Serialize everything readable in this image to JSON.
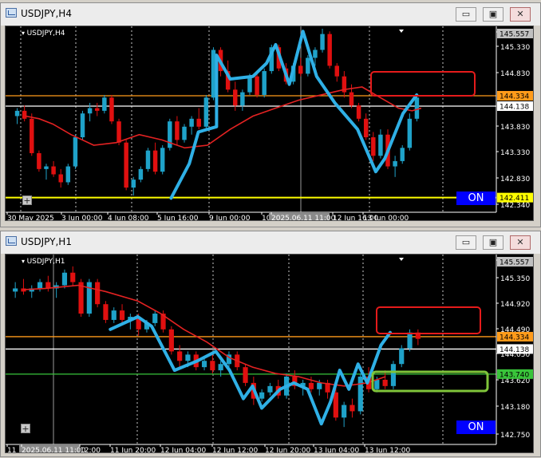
{
  "colors": {
    "bg": "#000000",
    "bull": "#1fa2c9",
    "bear": "#e01010",
    "ma": "#e32222",
    "trend": "#2fb0e6",
    "orange_line": "#ff9b1a",
    "white_line": "#ffffff",
    "yellow_line": "#ffff00",
    "green_line": "#39c43a",
    "red_box": "#e51b1b",
    "green_box": "#7fc43a",
    "on_button": "#0000ff"
  },
  "windows": [
    {
      "title": "USDJPY,H4",
      "symbol_label": "USDJPY,H4",
      "buttons": {
        "minimize": "▭",
        "maximize": "▣",
        "close": "✕"
      },
      "on_label": "ON",
      "plus_label": "+",
      "price_axis": [
        "145.557",
        "145.330",
        "144.830",
        "143.830",
        "143.330",
        "142.830",
        "142.340"
      ],
      "price_tags": [
        {
          "label": "145.557",
          "style": "grey"
        },
        {
          "label": "144.334",
          "style": "orange"
        },
        {
          "label": "144.138",
          "style": "white"
        },
        {
          "label": "142.411",
          "style": "yellow"
        }
      ],
      "time_axis": [
        "30 May 2025",
        "3 Jun 00:00",
        "4 Jun 08:00",
        "5 Jun 16:00",
        "9 Jun 00:00",
        "10 Jun 08:00",
        "2025.06.11 11:00",
        "12 Jun 16:00",
        "13 Jun 00:00"
      ],
      "crosshair_time": "2025.06.11 11:00",
      "chart_data": {
        "type": "candlestick",
        "symbol": "USDJPY",
        "timeframe": "H4",
        "ylim": [
          142.3,
          145.6
        ],
        "horizontal_lines": {
          "orange": 144.334,
          "white": 144.138,
          "yellow": 142.411
        },
        "moving_average_path": [
          [
            0,
            143.95
          ],
          [
            0.03,
            143.9
          ],
          [
            0.06,
            143.8
          ],
          [
            0.1,
            143.6
          ],
          [
            0.15,
            143.4
          ],
          [
            0.2,
            143.45
          ],
          [
            0.25,
            143.6
          ],
          [
            0.3,
            143.5
          ],
          [
            0.35,
            143.35
          ],
          [
            0.4,
            143.4
          ],
          [
            0.45,
            143.7
          ],
          [
            0.5,
            143.95
          ],
          [
            0.55,
            144.1
          ],
          [
            0.6,
            144.25
          ],
          [
            0.65,
            144.35
          ],
          [
            0.7,
            144.45
          ],
          [
            0.74,
            144.5
          ],
          [
            0.78,
            144.3
          ],
          [
            0.82,
            144.1
          ],
          [
            0.85,
            144.05
          ],
          [
            0.87,
            144.1
          ]
        ],
        "trend_path": [
          [
            0.32,
            142.4
          ],
          [
            0.36,
            143.05
          ],
          [
            0.38,
            143.65
          ],
          [
            0.42,
            143.75
          ],
          [
            0.42,
            145.1
          ],
          [
            0.45,
            144.65
          ],
          [
            0.5,
            144.7
          ],
          [
            0.53,
            144.95
          ],
          [
            0.55,
            145.3
          ],
          [
            0.58,
            144.55
          ],
          [
            0.61,
            145.55
          ],
          [
            0.64,
            144.7
          ],
          [
            0.68,
            144.2
          ],
          [
            0.73,
            143.7
          ],
          [
            0.77,
            142.9
          ],
          [
            0.79,
            143.15
          ],
          [
            0.83,
            144.0
          ],
          [
            0.86,
            144.35
          ]
        ],
        "candles": [
          [
            143.95,
            144.1,
            143.8,
            144.05
          ],
          [
            144.05,
            144.15,
            143.85,
            143.9
          ],
          [
            143.9,
            144.0,
            143.2,
            143.25
          ],
          [
            143.25,
            143.3,
            142.9,
            142.95
          ],
          [
            142.95,
            143.05,
            142.75,
            143.0
          ],
          [
            143.0,
            143.1,
            142.8,
            142.85
          ],
          [
            142.85,
            142.95,
            142.6,
            142.7
          ],
          [
            142.7,
            143.05,
            142.65,
            143.0
          ],
          [
            143.0,
            143.6,
            142.95,
            143.55
          ],
          [
            143.55,
            144.05,
            143.5,
            144.0
          ],
          [
            144.0,
            144.2,
            143.85,
            144.1
          ],
          [
            144.1,
            144.2,
            143.95,
            144.05
          ],
          [
            144.05,
            144.35,
            144.0,
            144.3
          ],
          [
            144.3,
            144.35,
            143.8,
            143.85
          ],
          [
            143.85,
            143.9,
            143.4,
            143.45
          ],
          [
            143.45,
            143.5,
            142.55,
            142.6
          ],
          [
            142.6,
            142.8,
            142.45,
            142.75
          ],
          [
            142.75,
            143.0,
            142.7,
            142.95
          ],
          [
            142.95,
            143.35,
            142.9,
            143.3
          ],
          [
            143.3,
            143.45,
            142.85,
            142.9
          ],
          [
            142.9,
            143.4,
            142.85,
            143.35
          ],
          [
            143.35,
            143.9,
            143.3,
            143.85
          ],
          [
            143.85,
            143.95,
            143.4,
            143.5
          ],
          [
            143.5,
            143.8,
            143.45,
            143.75
          ],
          [
            143.75,
            143.95,
            143.6,
            143.9
          ],
          [
            143.9,
            144.1,
            143.7,
            143.75
          ],
          [
            143.75,
            144.35,
            143.7,
            144.3
          ],
          [
            144.3,
            145.25,
            144.25,
            145.2
          ],
          [
            145.2,
            145.25,
            144.7,
            144.8
          ],
          [
            144.8,
            145.0,
            144.4,
            144.45
          ],
          [
            144.45,
            144.6,
            144.05,
            144.15
          ],
          [
            144.15,
            144.45,
            144.05,
            144.4
          ],
          [
            144.4,
            144.75,
            144.35,
            144.7
          ],
          [
            144.7,
            144.8,
            144.3,
            144.35
          ],
          [
            144.35,
            144.85,
            144.3,
            144.8
          ],
          [
            144.8,
            145.3,
            144.75,
            145.25
          ],
          [
            145.25,
            145.3,
            144.8,
            144.85
          ],
          [
            144.85,
            144.95,
            144.55,
            144.6
          ],
          [
            144.6,
            144.95,
            144.55,
            144.9
          ],
          [
            144.9,
            145.05,
            144.7,
            144.75
          ],
          [
            144.75,
            145.1,
            144.7,
            145.05
          ],
          [
            145.05,
            145.25,
            144.9,
            145.2
          ],
          [
            145.2,
            145.6,
            145.15,
            145.5
          ],
          [
            145.5,
            145.55,
            144.85,
            144.9
          ],
          [
            144.9,
            144.95,
            144.6,
            144.7
          ],
          [
            144.7,
            144.8,
            144.3,
            144.4
          ],
          [
            144.4,
            144.55,
            144.1,
            144.15
          ],
          [
            144.15,
            144.2,
            143.85,
            143.9
          ],
          [
            143.9,
            144.0,
            143.5,
            143.55
          ],
          [
            143.55,
            143.65,
            143.1,
            143.2
          ],
          [
            143.2,
            143.7,
            143.15,
            143.6
          ],
          [
            143.6,
            143.7,
            142.95,
            143.0
          ],
          [
            143.0,
            143.2,
            142.8,
            143.1
          ],
          [
            143.1,
            143.4,
            143.05,
            143.35
          ],
          [
            143.35,
            144.0,
            143.3,
            143.9
          ],
          [
            143.9,
            144.35,
            143.85,
            144.3
          ]
        ]
      }
    },
    {
      "title": "USDJPY,H1",
      "symbol_label": "USDJPY,H1",
      "buttons": {
        "minimize": "▭",
        "maximize": "▣",
        "close": "✕"
      },
      "on_label": "ON",
      "plus_label": "+",
      "price_axis": [
        "145.557",
        "145.350",
        "144.920",
        "144.490",
        "144.050",
        "143.620",
        "143.180",
        "142.750"
      ],
      "price_tags": [
        {
          "label": "145.557",
          "style": "grey"
        },
        {
          "label": "144.334",
          "style": "orange"
        },
        {
          "label": "144.138",
          "style": "white"
        },
        {
          "label": "143.740",
          "style": "green"
        }
      ],
      "time_axis": [
        "11 Jun",
        "2025.06.11 11:00",
        "12:00",
        "11 Jun 20:00",
        "12 Jun 04:00",
        "12 Jun 12:00",
        "12 Jun 20:00",
        "13 Jun 04:00",
        "13 Jun 12:00"
      ],
      "crosshair_time": "2025.06.11 11:00",
      "chart_data": {
        "type": "candlestick",
        "symbol": "USDJPY",
        "timeframe": "H1",
        "ylim": [
          142.75,
          145.6
        ],
        "horizontal_lines": {
          "orange": 144.334,
          "white": 144.138,
          "green": 143.74
        },
        "moving_average_path": [
          [
            0,
            145.08
          ],
          [
            0.05,
            145.1
          ],
          [
            0.12,
            145.15
          ],
          [
            0.18,
            145.05
          ],
          [
            0.25,
            144.9
          ],
          [
            0.3,
            144.7
          ],
          [
            0.35,
            144.45
          ],
          [
            0.4,
            144.25
          ],
          [
            0.45,
            144.0
          ],
          [
            0.5,
            143.85
          ],
          [
            0.55,
            143.75
          ],
          [
            0.6,
            143.7
          ],
          [
            0.65,
            143.6
          ],
          [
            0.7,
            143.55
          ],
          [
            0.75,
            143.6
          ],
          [
            0.79,
            143.7
          ]
        ],
        "trend_path": [
          [
            0.19,
            144.45
          ],
          [
            0.25,
            144.65
          ],
          [
            0.28,
            144.5
          ],
          [
            0.33,
            143.8
          ],
          [
            0.38,
            143.95
          ],
          [
            0.42,
            144.1
          ],
          [
            0.45,
            143.8
          ],
          [
            0.48,
            143.35
          ],
          [
            0.5,
            143.55
          ],
          [
            0.52,
            143.2
          ],
          [
            0.56,
            143.5
          ],
          [
            0.59,
            143.6
          ],
          [
            0.62,
            143.5
          ],
          [
            0.65,
            142.95
          ],
          [
            0.67,
            143.3
          ],
          [
            0.69,
            143.8
          ],
          [
            0.71,
            143.5
          ],
          [
            0.73,
            143.9
          ],
          [
            0.75,
            143.6
          ],
          [
            0.78,
            144.2
          ],
          [
            0.8,
            144.4
          ]
        ],
        "candles": [
          [
            145.05,
            145.2,
            144.95,
            145.1
          ],
          [
            145.1,
            145.25,
            145.0,
            145.05
          ],
          [
            145.05,
            145.15,
            144.95,
            145.1
          ],
          [
            145.1,
            145.25,
            145.05,
            145.2
          ],
          [
            145.2,
            145.3,
            145.05,
            145.1
          ],
          [
            145.1,
            145.2,
            144.95,
            145.15
          ],
          [
            145.15,
            145.4,
            145.1,
            145.35
          ],
          [
            145.35,
            145.45,
            145.15,
            145.2
          ],
          [
            145.2,
            145.25,
            144.65,
            144.7
          ],
          [
            144.7,
            145.25,
            144.65,
            145.2
          ],
          [
            145.2,
            145.25,
            144.8,
            144.85
          ],
          [
            144.85,
            144.9,
            144.55,
            144.6
          ],
          [
            144.6,
            144.8,
            144.55,
            144.75
          ],
          [
            144.75,
            144.85,
            144.55,
            144.6
          ],
          [
            144.6,
            144.7,
            144.45,
            144.65
          ],
          [
            144.65,
            144.7,
            144.35,
            144.45
          ],
          [
            144.45,
            144.6,
            144.4,
            144.55
          ],
          [
            144.55,
            144.75,
            144.5,
            144.7
          ],
          [
            144.7,
            144.75,
            144.4,
            144.45
          ],
          [
            144.45,
            144.5,
            144.05,
            144.1
          ],
          [
            144.1,
            144.2,
            143.85,
            143.95
          ],
          [
            143.95,
            144.1,
            143.85,
            144.05
          ],
          [
            144.05,
            144.1,
            143.8,
            143.85
          ],
          [
            143.85,
            144.0,
            143.8,
            143.95
          ],
          [
            143.95,
            144.05,
            143.75,
            143.8
          ],
          [
            143.8,
            143.95,
            143.7,
            143.9
          ],
          [
            143.9,
            144.1,
            143.85,
            144.05
          ],
          [
            144.05,
            144.1,
            143.8,
            143.85
          ],
          [
            143.85,
            143.9,
            143.55,
            143.6
          ],
          [
            143.6,
            143.7,
            143.25,
            143.35
          ],
          [
            143.35,
            143.5,
            143.3,
            143.45
          ],
          [
            143.45,
            143.6,
            143.4,
            143.55
          ],
          [
            143.55,
            143.65,
            143.35,
            143.4
          ],
          [
            143.4,
            143.75,
            143.35,
            143.7
          ],
          [
            143.7,
            143.8,
            143.5,
            143.55
          ],
          [
            143.55,
            143.65,
            143.4,
            143.6
          ],
          [
            143.6,
            143.7,
            143.45,
            143.5
          ],
          [
            143.5,
            143.65,
            143.4,
            143.6
          ],
          [
            143.6,
            143.65,
            143.35,
            143.45
          ],
          [
            143.45,
            143.55,
            143.0,
            143.05
          ],
          [
            143.05,
            143.3,
            142.9,
            143.25
          ],
          [
            143.25,
            143.35,
            143.05,
            143.15
          ],
          [
            143.15,
            143.75,
            143.1,
            143.7
          ],
          [
            143.7,
            143.85,
            143.45,
            143.5
          ],
          [
            143.5,
            143.7,
            143.45,
            143.65
          ],
          [
            143.65,
            143.8,
            143.5,
            143.55
          ],
          [
            143.55,
            143.95,
            143.5,
            143.9
          ],
          [
            143.9,
            144.2,
            143.85,
            144.15
          ],
          [
            144.15,
            144.45,
            144.1,
            144.4
          ],
          [
            144.4,
            144.45,
            144.2,
            144.3
          ]
        ]
      }
    }
  ]
}
